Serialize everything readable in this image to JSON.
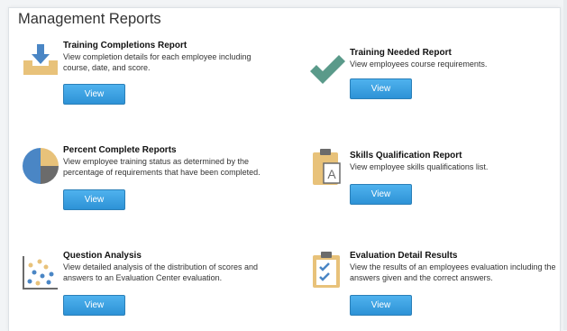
{
  "page": {
    "title": "Management Reports"
  },
  "reports": [
    {
      "id": "training-completions",
      "title": "Training Completions Report",
      "description": "View completion details for each employee including course, date, and score.",
      "button_label": "View",
      "icon": "download-tray-icon"
    },
    {
      "id": "training-needed",
      "title": "Training Needed Report",
      "description": "View employees course requirements.",
      "button_label": "View",
      "icon": "checkmark-icon"
    },
    {
      "id": "percent-complete",
      "title": "Percent Complete Reports",
      "description": "View employee training status as determined by the percentage of requirements that have been completed.",
      "button_label": "View",
      "icon": "pie-chart-icon"
    },
    {
      "id": "skills-qualification",
      "title": "Skills Qualification Report",
      "description": "View employee skills qualifications list.",
      "button_label": "View",
      "icon": "clipboard-a-icon"
    },
    {
      "id": "question-analysis",
      "title": "Question Analysis",
      "description": "View detailed analysis of the distribution of scores and answers to an Evaluation Center evaluation.",
      "button_label": "View",
      "icon": "scatter-plot-icon"
    },
    {
      "id": "evaluation-detail",
      "title": "Evaluation Detail Results",
      "description": "View the results of an employees evaluation including the answers given and the correct answers.",
      "button_label": "View",
      "icon": "clipboard-check-icon"
    }
  ],
  "colors": {
    "accent": "#3a9fe0",
    "icon_blue": "#4a86c5",
    "icon_tan": "#e8c27a",
    "icon_green": "#5a9a8a",
    "icon_grey": "#6b6b6b"
  }
}
